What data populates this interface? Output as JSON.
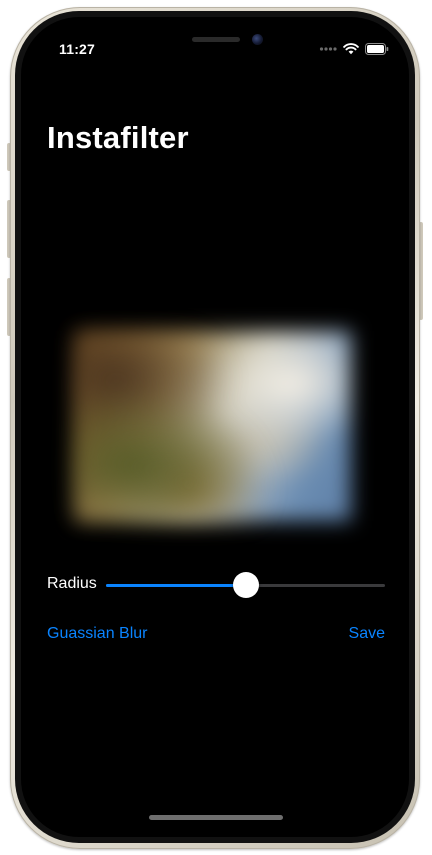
{
  "status_bar": {
    "time": "11:27",
    "icons": [
      "signal-dots-icon",
      "wifi-icon",
      "battery-icon"
    ]
  },
  "nav": {
    "title": "Instafilter"
  },
  "image": {
    "description": "blurred photo",
    "filter_applied": "blur"
  },
  "controls": {
    "slider_label": "Radius",
    "slider_value": 0.5,
    "filter_button_label": "Guassian Blur",
    "save_button_label": "Save"
  },
  "colors": {
    "accent": "#0a84ff",
    "background": "#000000",
    "text": "#ffffff"
  }
}
